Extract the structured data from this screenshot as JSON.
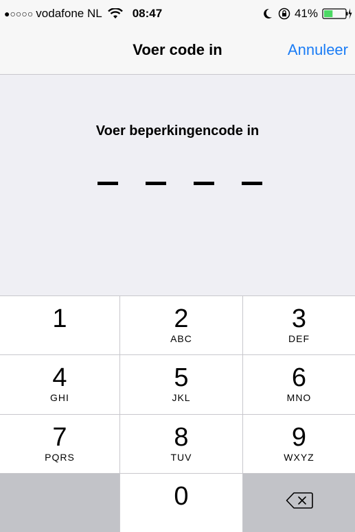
{
  "status_bar": {
    "signal": "●○○○○",
    "carrier": "vodafone NL",
    "time": "08:47",
    "battery_percent": "41%",
    "icons": [
      "wifi-icon",
      "moon-icon",
      "rotation-lock-icon",
      "battery-icon",
      "charging-icon"
    ],
    "battery_level": 0.41,
    "battery_color": "#4cd964"
  },
  "nav": {
    "title": "Voer code in",
    "cancel_label": "Annuleer",
    "accent_color": "#1a7cf5"
  },
  "prompt": {
    "label": "Voer beperkingencode in",
    "digits_entered": 0,
    "digits_total": 4
  },
  "keypad": {
    "keys": [
      {
        "num": "1",
        "letters": ""
      },
      {
        "num": "2",
        "letters": "ABC"
      },
      {
        "num": "3",
        "letters": "DEF"
      },
      {
        "num": "4",
        "letters": "GHI"
      },
      {
        "num": "5",
        "letters": "JKL"
      },
      {
        "num": "6",
        "letters": "MNO"
      },
      {
        "num": "7",
        "letters": "PQRS"
      },
      {
        "num": "8",
        "letters": "TUV"
      },
      {
        "num": "9",
        "letters": "WXYZ"
      },
      {
        "num": "0",
        "letters": ""
      }
    ],
    "backspace_icon": "backspace-icon"
  }
}
